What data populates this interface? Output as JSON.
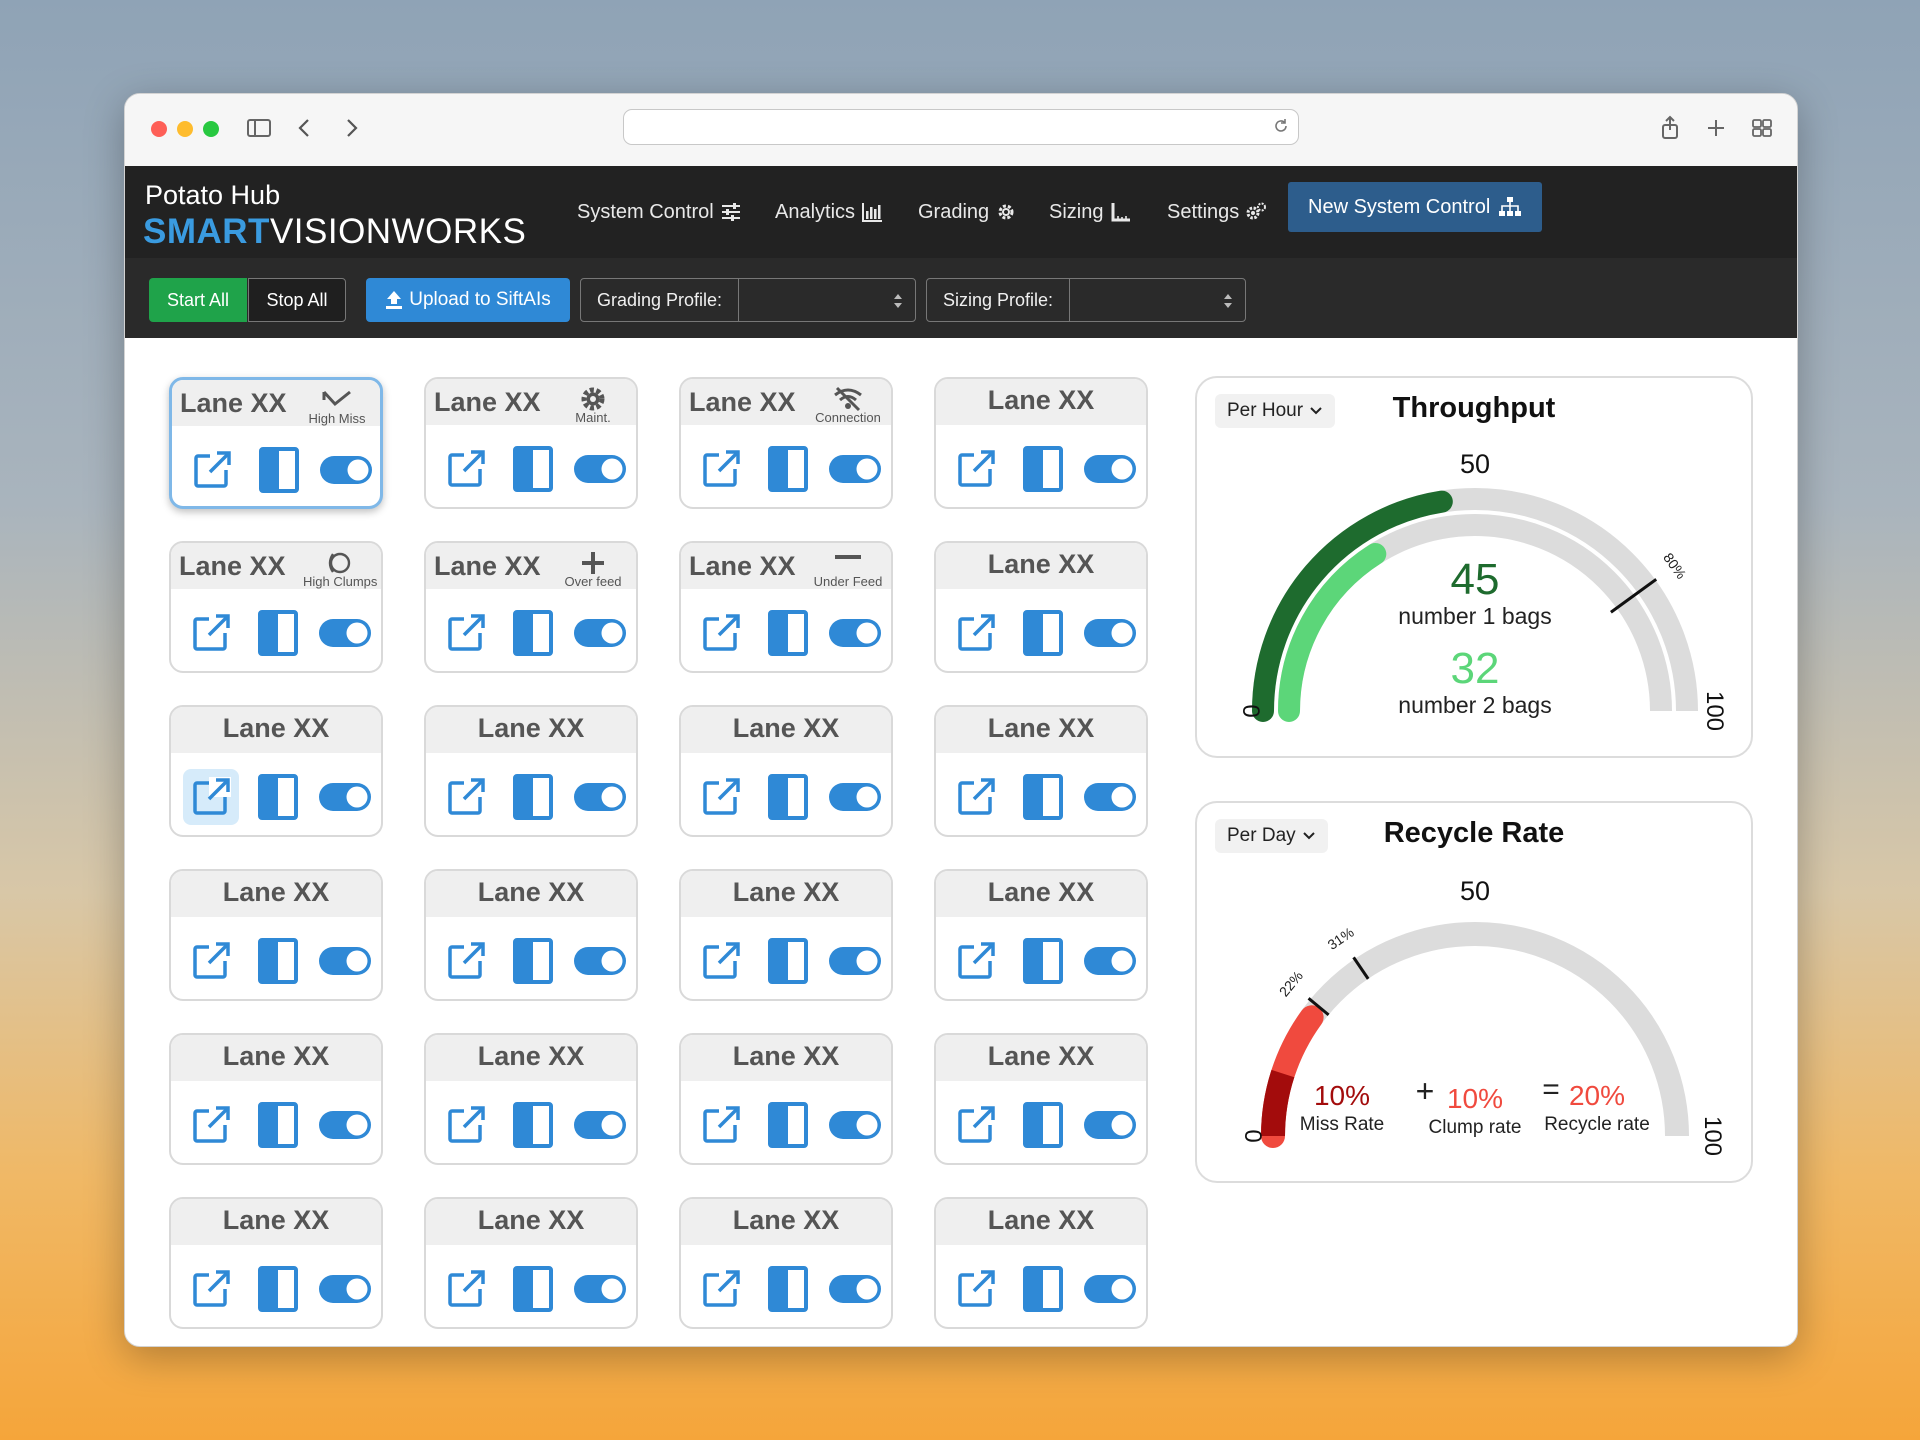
{
  "app": {
    "brand_line1": "Potato Hub",
    "brand_smart": "SMART",
    "brand_rest": "VISIONWORKS"
  },
  "nav": {
    "system_control": "System Control",
    "analytics": "Analytics",
    "grading": "Grading",
    "sizing": "Sizing",
    "settings": "Settings",
    "new_system_control": "New System Control"
  },
  "toolbar": {
    "start_all": "Start All",
    "stop_all": "Stop All",
    "upload": "Upload to SiftAIs",
    "grading_profile_label": "Grading Profile:",
    "grading_profile_value": "",
    "sizing_profile_label": "Sizing Profile:",
    "sizing_profile_value": ""
  },
  "lanes": [
    {
      "title": "Lane XX",
      "status": "High Miss",
      "status_icon": "high-miss-icon",
      "enabled": true
    },
    {
      "title": "Lane XX",
      "status": "Maint.",
      "status_icon": "gear-icon",
      "enabled": true
    },
    {
      "title": "Lane XX",
      "status": "Connection",
      "status_icon": "no-connection-icon",
      "enabled": true
    },
    {
      "title": "Lane XX",
      "status": "",
      "status_icon": "",
      "enabled": true
    },
    {
      "title": "Lane XX",
      "status": "High Clumps",
      "status_icon": "high-clumps-icon",
      "enabled": true
    },
    {
      "title": "Lane XX",
      "status": "Over feed",
      "status_icon": "plus-icon",
      "enabled": true
    },
    {
      "title": "Lane XX",
      "status": "Under Feed",
      "status_icon": "minus-icon",
      "enabled": true
    },
    {
      "title": "Lane XX",
      "status": "",
      "status_icon": "",
      "enabled": true
    },
    {
      "title": "Lane XX",
      "status": "",
      "status_icon": "",
      "enabled": true
    },
    {
      "title": "Lane XX",
      "status": "",
      "status_icon": "",
      "enabled": true
    },
    {
      "title": "Lane XX",
      "status": "",
      "status_icon": "",
      "enabled": true
    },
    {
      "title": "Lane XX",
      "status": "",
      "status_icon": "",
      "enabled": true
    },
    {
      "title": "Lane XX",
      "status": "",
      "status_icon": "",
      "enabled": true
    },
    {
      "title": "Lane XX",
      "status": "",
      "status_icon": "",
      "enabled": true
    },
    {
      "title": "Lane XX",
      "status": "",
      "status_icon": "",
      "enabled": true
    },
    {
      "title": "Lane XX",
      "status": "",
      "status_icon": "",
      "enabled": true
    },
    {
      "title": "Lane XX",
      "status": "",
      "status_icon": "",
      "enabled": true
    },
    {
      "title": "Lane XX",
      "status": "",
      "status_icon": "",
      "enabled": true
    },
    {
      "title": "Lane XX",
      "status": "",
      "status_icon": "",
      "enabled": true
    },
    {
      "title": "Lane XX",
      "status": "",
      "status_icon": "",
      "enabled": true
    },
    {
      "title": "Lane XX",
      "status": "",
      "status_icon": "",
      "enabled": true
    },
    {
      "title": "Lane XX",
      "status": "",
      "status_icon": "",
      "enabled": true
    },
    {
      "title": "Lane XX",
      "status": "",
      "status_icon": "",
      "enabled": true
    },
    {
      "title": "Lane XX",
      "status": "",
      "status_icon": "",
      "enabled": true
    }
  ],
  "throughput": {
    "title": "Throughput",
    "period": "Per Hour",
    "scale_min": "0",
    "scale_mid": "50",
    "scale_max": "100",
    "target_label": "80%",
    "target_value": 80,
    "value1": 45,
    "value1_label": "number 1 bags",
    "value2": 32,
    "value2_label": "number 2 bags"
  },
  "recycle": {
    "title": "Recycle Rate",
    "period": "Per Day",
    "scale_min": "0",
    "scale_mid": "50",
    "scale_max": "100",
    "marker1_label": "22%",
    "marker1_value": 22,
    "marker2_label": "31%",
    "marker2_value": 31,
    "miss_value": "10%",
    "miss_label": "Miss Rate",
    "clump_value": "10%",
    "clump_label": "Clump rate",
    "recycle_value": "20%",
    "recycle_label": "Recycle rate",
    "plus": "+",
    "equals": "=",
    "miss_fraction": 10,
    "recycle_fraction": 20
  },
  "colors": {
    "brand_blue": "#3a9be0",
    "action_blue": "#2f89d6",
    "dark_green": "#1e6b2e",
    "light_green": "#5cd679",
    "dark_red": "#a30c0c",
    "light_red": "#f04a3e"
  }
}
